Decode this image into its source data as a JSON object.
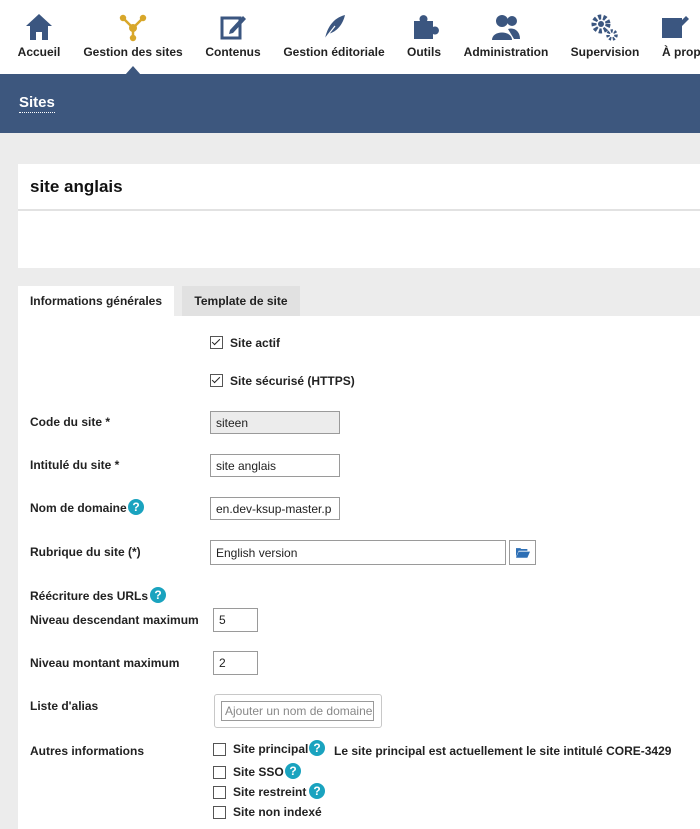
{
  "nav": {
    "items": [
      {
        "label": "Accueil",
        "icon": "home-icon"
      },
      {
        "label": "Gestion des sites",
        "icon": "sitemap-icon",
        "active": true
      },
      {
        "label": "Contenus",
        "icon": "edit-icon"
      },
      {
        "label": "Gestion éditoriale",
        "icon": "feather-icon"
      },
      {
        "label": "Outils",
        "icon": "puzzle-icon"
      },
      {
        "label": "Administration",
        "icon": "users-icon"
      },
      {
        "label": "Supervision",
        "icon": "gears-icon"
      },
      {
        "label": "À propos",
        "icon": "pencil-icon"
      }
    ]
  },
  "banner": {
    "title": "Sites"
  },
  "page": {
    "title": "site anglais"
  },
  "tabs": [
    {
      "label": "Informations générales",
      "active": true
    },
    {
      "label": "Template de site",
      "active": false
    }
  ],
  "form": {
    "site_actif": {
      "label": "Site actif",
      "checked": true
    },
    "site_securise": {
      "label": "Site sécurisé (HTTPS)",
      "checked": true
    },
    "code": {
      "label": "Code du site *",
      "value": "siteen"
    },
    "intitule": {
      "label": "Intitulé du site *",
      "value": "site anglais"
    },
    "domaine": {
      "label": "Nom de domaine",
      "value": "en.dev-ksup-master.p"
    },
    "rubrique": {
      "label": "Rubrique du site (*)",
      "value": "English version"
    },
    "reecriture": {
      "label": "Réécriture des URLs"
    },
    "niveau_desc": {
      "label": "Niveau descendant maximum",
      "value": "5"
    },
    "niveau_mont": {
      "label": "Niveau montant maximum",
      "value": "2"
    },
    "alias": {
      "label": "Liste d'alias",
      "placeholder": "Ajouter un nom de domaine"
    },
    "autres": {
      "label": "Autres informations",
      "site_principal": {
        "label": "Site principal",
        "checked": false,
        "note": "Le site principal est actuellement le site intitulé CORE-3429"
      },
      "site_sso": {
        "label": "Site SSO",
        "checked": false
      },
      "site_restreint": {
        "label": "Site restreint",
        "checked": false
      },
      "site_non_indexe": {
        "label": "Site non indexé",
        "checked": false
      }
    }
  },
  "colors": {
    "nav_text": "#3b5680",
    "banner_bg": "#3d577e",
    "icon_gold": "#d8a72a",
    "help_bg": "#1aa3bf"
  }
}
